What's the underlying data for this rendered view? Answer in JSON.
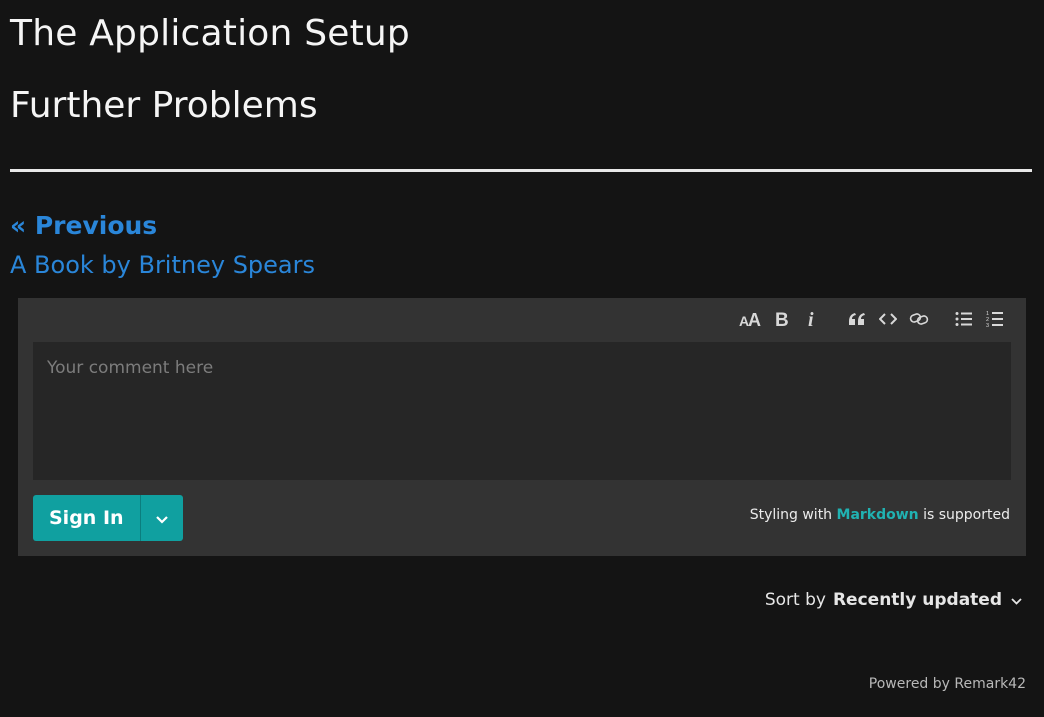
{
  "page": {
    "heading": "The Application Setup",
    "subheading": "Further Problems"
  },
  "pagination": {
    "previous_label": "« Previous",
    "previous_title": "A Book by Britney Spears"
  },
  "comment_form": {
    "toolbar": [
      {
        "name": "header-icon",
        "label": "AA"
      },
      {
        "name": "bold-icon",
        "label": "B"
      },
      {
        "name": "italic-icon",
        "label": "i"
      },
      {
        "name": "quote-icon",
        "label": "quote"
      },
      {
        "name": "code-icon",
        "label": "code"
      },
      {
        "name": "link-icon",
        "label": "link"
      },
      {
        "name": "unordered-list-icon",
        "label": "unordered list"
      },
      {
        "name": "ordered-list-icon",
        "label": "ordered list"
      }
    ],
    "placeholder": "Your comment here",
    "sign_in_label": "Sign In",
    "markdown_prefix": "Styling with",
    "markdown_link": "Markdown",
    "markdown_suffix": "is supported"
  },
  "sort": {
    "label": "Sort by",
    "value": "Recently updated"
  },
  "footer": {
    "powered_by": "Powered by Remark42"
  },
  "colors": {
    "background": "#141414",
    "link": "#2a86d9",
    "accent": "#10a0a0",
    "panel": "#333333",
    "input": "#262626"
  }
}
